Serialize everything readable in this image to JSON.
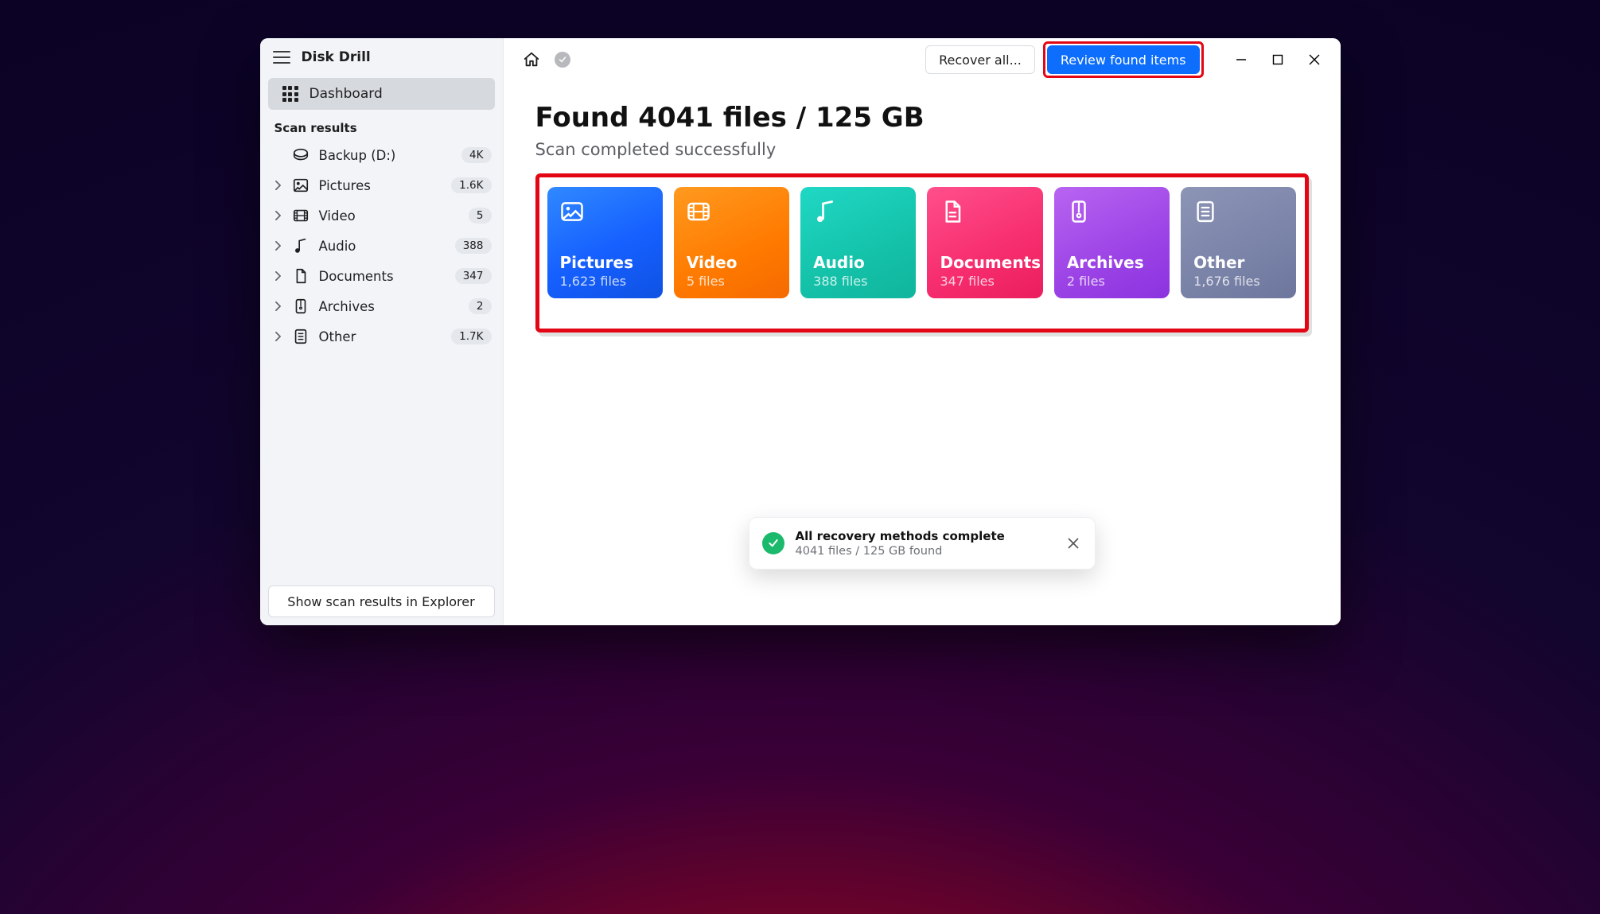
{
  "app": {
    "title": "Disk Drill"
  },
  "sidebar": {
    "dashboard_label": "Dashboard",
    "section_label": "Scan results",
    "backup": {
      "label": "Backup (D:)",
      "badge": "4K"
    },
    "items": [
      {
        "label": "Pictures",
        "badge": "1.6K"
      },
      {
        "label": "Video",
        "badge": "5"
      },
      {
        "label": "Audio",
        "badge": "388"
      },
      {
        "label": "Documents",
        "badge": "347"
      },
      {
        "label": "Archives",
        "badge": "2"
      },
      {
        "label": "Other",
        "badge": "1.7K"
      }
    ],
    "footer_button": "Show scan results in Explorer"
  },
  "topbar": {
    "recover_all_label": "Recover all...",
    "review_label": "Review found items"
  },
  "main": {
    "headline": "Found 4041 files / 125 GB",
    "subhead": "Scan completed successfully",
    "cards": {
      "pictures": {
        "title": "Pictures",
        "files": "1,623 files"
      },
      "video": {
        "title": "Video",
        "files": "5 files"
      },
      "audio": {
        "title": "Audio",
        "files": "388 files"
      },
      "documents": {
        "title": "Documents",
        "files": "347 files"
      },
      "archives": {
        "title": "Archives",
        "files": "2 files"
      },
      "other": {
        "title": "Other",
        "files": "1,676 files"
      }
    }
  },
  "toast": {
    "title": "All recovery methods complete",
    "subtitle": "4041 files / 125 GB found"
  },
  "colors": {
    "accent": "#e30614",
    "primary": "#0d6efd",
    "success": "#1bb96b"
  }
}
